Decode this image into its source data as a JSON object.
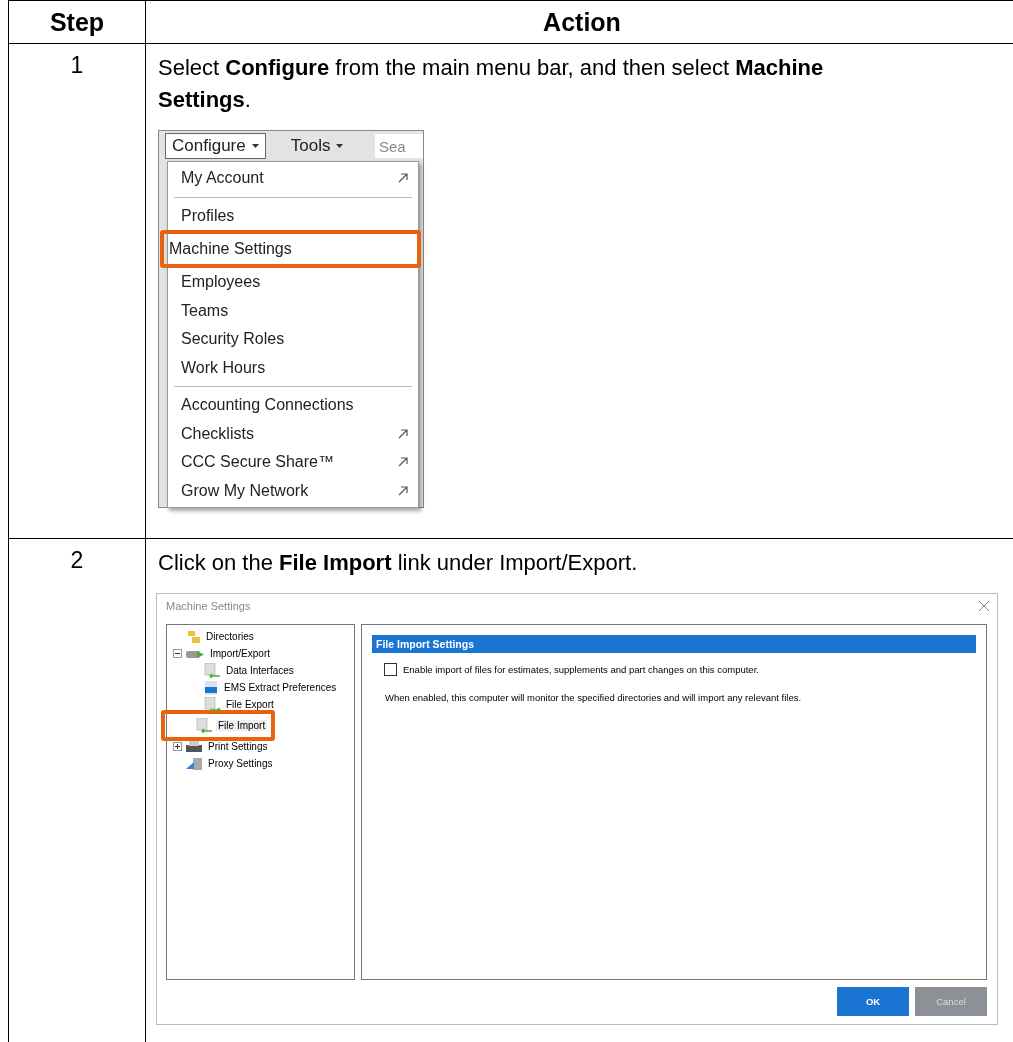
{
  "table": {
    "columns": [
      "Step",
      "Action"
    ],
    "rows": [
      {
        "step": "1",
        "instruction": "Select **Configure** from the main menu bar, and then select **Machine Settings**.",
        "kind": "menu",
        "menu": {
          "menubar": [
            {
              "label": "Configure",
              "selected": true
            },
            {
              "label": "Tools",
              "selected": false
            }
          ],
          "search": {
            "placeholder": "Sea"
          },
          "groups": [
            [
              {
                "label": "My Account",
                "external": true,
                "highlighted": false
              }
            ],
            [
              {
                "label": "Profiles",
                "external": false,
                "highlighted": false
              },
              {
                "label": "Machine Settings",
                "external": false,
                "highlighted": true
              },
              {
                "label": "Employees",
                "external": false,
                "highlighted": false
              },
              {
                "label": "Teams",
                "external": false,
                "highlighted": false
              },
              {
                "label": "Security Roles",
                "external": false,
                "highlighted": false
              },
              {
                "label": "Work Hours",
                "external": false,
                "highlighted": false
              }
            ],
            [
              {
                "label": "Accounting Connections",
                "external": false,
                "highlighted": false
              },
              {
                "label": "Checklists",
                "external": true,
                "highlighted": false
              },
              {
                "label": "CCC Secure Share™",
                "external": true,
                "highlighted": false
              },
              {
                "label": "Grow My Network",
                "external": true,
                "highlighted": false
              }
            ]
          ]
        }
      },
      {
        "step": "2",
        "instruction": "Click on the **File Import** link under Import/Export.",
        "kind": "dialog",
        "dialog": {
          "title": "Machine Settings",
          "tree": [
            {
              "label": "Directories",
              "kind": "folder",
              "highlighted": false
            },
            {
              "label": "Import/Export",
              "kind": "drive",
              "expanded": true,
              "highlighted": false,
              "children": [
                {
                  "label": "Data Interfaces",
                  "kind": "import",
                  "highlighted": false
                },
                {
                  "label": "EMS Extract Preferences",
                  "kind": "extract",
                  "highlighted": false
                },
                {
                  "label": "File Export",
                  "kind": "export",
                  "highlighted": false
                },
                {
                  "label": "File Import",
                  "kind": "import",
                  "highlighted": true
                }
              ]
            },
            {
              "label": "Print Settings",
              "kind": "printer",
              "expanded": false,
              "highlighted": false
            },
            {
              "label": "Proxy Settings",
              "kind": "proxy",
              "highlighted": false
            }
          ],
          "section_title": "File Import Settings",
          "checkbox": {
            "label": "Enable import of files for estimates, supplements and part changes on this computer.",
            "checked": false
          },
          "note": "When enabled, this computer will monitor the specified directories and will import any relevant files.",
          "buttons": [
            {
              "label": "OK",
              "kind": "primary"
            },
            {
              "label": "Cancel",
              "kind": "secondary"
            }
          ]
        }
      }
    ]
  }
}
